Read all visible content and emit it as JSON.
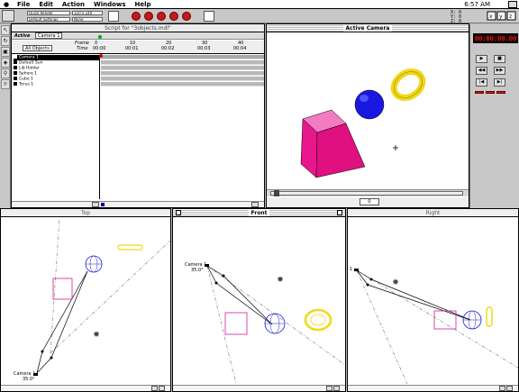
{
  "menubar": {
    "items": [
      "File",
      "Edit",
      "Action",
      "Windows",
      "Help"
    ],
    "clock": "6:57 AM"
  },
  "toolbar": {
    "render_mode": "Quick Render",
    "resolution": "320 x 240",
    "settings": "Default Settings",
    "shading": "None",
    "coords": {
      "x": "X:  0",
      "y": "Y:  0",
      "z": "Z:  0"
    }
  },
  "script": {
    "title": "Script for \"3objects.mdl\"",
    "active_label": "Active",
    "active_value": "Camera 1",
    "filter": "All Objects",
    "frame_label": "Frame",
    "time_label": "Time",
    "ruler_frames": [
      "0",
      "10",
      "20",
      "30",
      "40"
    ],
    "ruler_times": [
      "00:00",
      "00:01",
      "00:02",
      "00:03",
      "00:04"
    ],
    "objects": [
      "Camera 1",
      "Default Sun",
      "Lib Holder",
      "Sphere 1",
      "Cube 1",
      "Torus 1"
    ]
  },
  "active_camera": {
    "title": "Active Camera",
    "frame_value": "0"
  },
  "controls": {
    "timecode": "00:00:00.00"
  },
  "views": {
    "top": {
      "title": "Top",
      "camera_name": "Camera 1",
      "camera_angle": "35.0°"
    },
    "front": {
      "title": "Front",
      "camera_name": "Camera 1",
      "camera_angle": "35.0°"
    },
    "right": {
      "title": "Right",
      "camera_name": "1"
    }
  },
  "colors": {
    "cube": "#e8188c",
    "sphere": "#1818e0",
    "torus": "#f0d818",
    "timecode": "#ff3020"
  }
}
